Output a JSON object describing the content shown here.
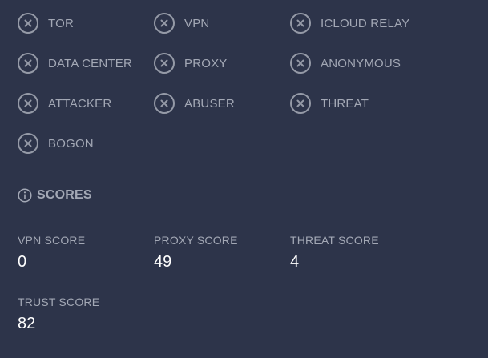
{
  "flags": [
    {
      "label": "TOR",
      "icon": "x-circle-icon"
    },
    {
      "label": "VPN",
      "icon": "x-circle-icon"
    },
    {
      "label": "ICLOUD RELAY",
      "icon": "x-circle-icon"
    },
    {
      "label": "DATA CENTER",
      "icon": "x-circle-icon"
    },
    {
      "label": "PROXY",
      "icon": "x-circle-icon"
    },
    {
      "label": "ANONYMOUS",
      "icon": "x-circle-icon"
    },
    {
      "label": "ATTACKER",
      "icon": "x-circle-icon"
    },
    {
      "label": "ABUSER",
      "icon": "x-circle-icon"
    },
    {
      "label": "THREAT",
      "icon": "x-circle-icon"
    },
    {
      "label": "BOGON",
      "icon": "x-circle-icon"
    }
  ],
  "scores": {
    "title": "SCORES",
    "icon": "info-icon",
    "items": [
      {
        "label": "VPN SCORE",
        "value": "0"
      },
      {
        "label": "PROXY SCORE",
        "value": "49"
      },
      {
        "label": "THREAT SCORE",
        "value": "4"
      },
      {
        "label": "TRUST SCORE",
        "value": "82"
      }
    ]
  },
  "colors": {
    "background": "#2d344a",
    "label": "#a3a8b5",
    "icon_stroke": "#959aa7",
    "value": "#ffffff",
    "divider": "#454c61"
  }
}
